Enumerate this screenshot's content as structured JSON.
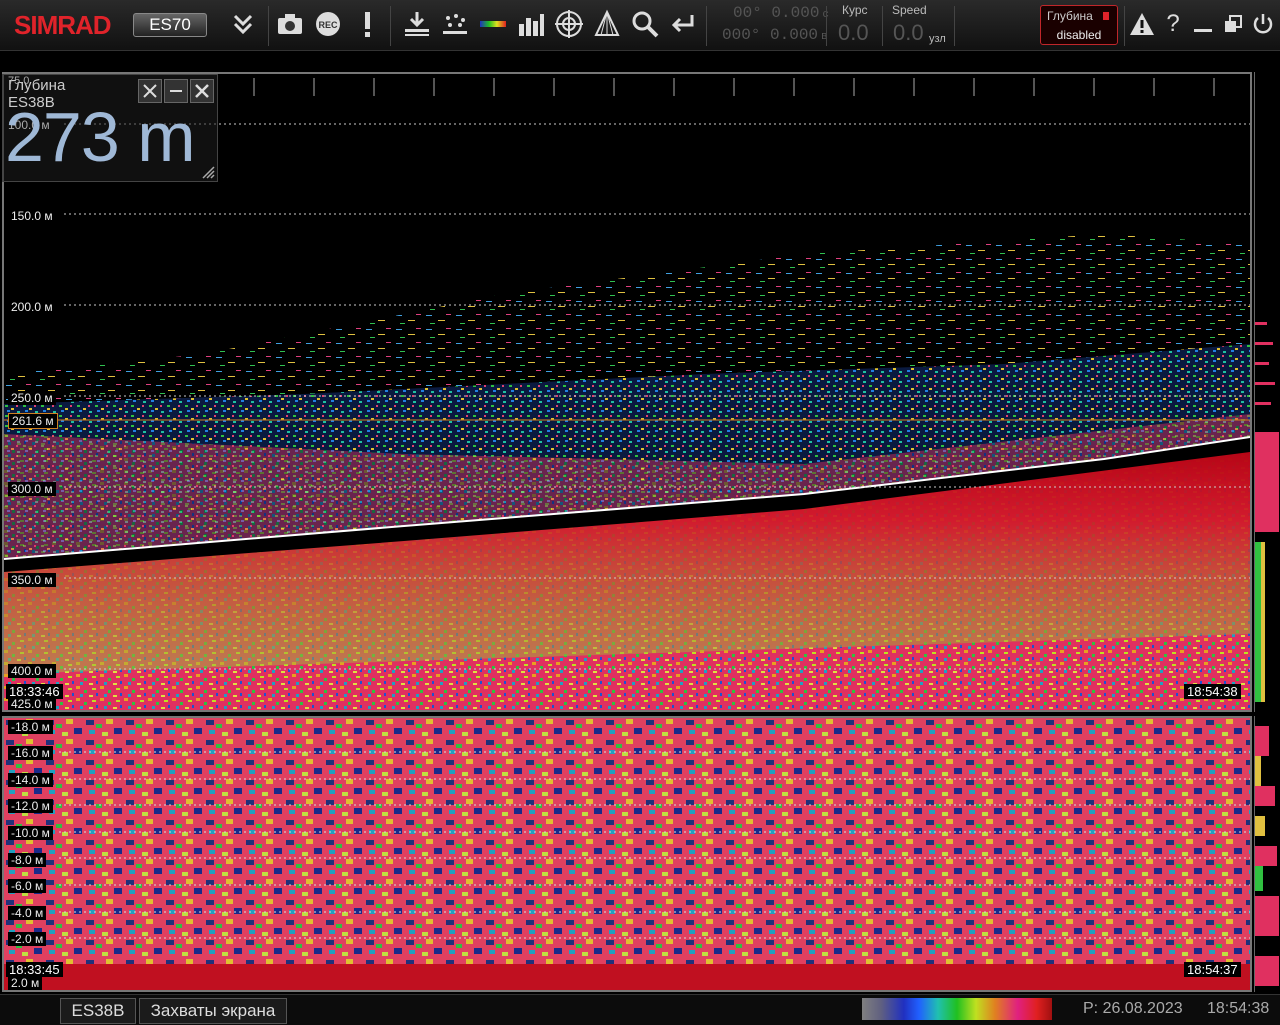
{
  "toolbar": {
    "logo": "SIMRAD",
    "model": "ES70",
    "lat": "00° 0.000",
    "lat_hem": "c",
    "lon": "000° 0.000",
    "lon_hem": "в",
    "course_label": "Курс",
    "course_value": "0.0",
    "speed_label": "Speed",
    "speed_value": "0.0",
    "speed_unit": "узл",
    "alarm_label": "Глубина",
    "alarm_state": "disabled",
    "help": "?",
    "record_label": "REC",
    "icons": [
      "expand-icon",
      "camera-icon",
      "record-icon",
      "event-icon",
      "bottom-icon",
      "noise-icon",
      "palette-icon",
      "histogram-icon",
      "target-icon",
      "transducer-icon",
      "zoom-icon",
      "back-icon",
      "warning-icon",
      "help-icon",
      "minimize-icon",
      "restore-icon",
      "power-icon"
    ]
  },
  "depth_panel": {
    "title": "Глубина",
    "channel": "ES38B",
    "value": "273 m",
    "range_top": "75.0",
    "tick_top": "100.0 м"
  },
  "echogram": {
    "depth_labels": [
      "150.0 м",
      "200.0 м",
      "250.0 м",
      "300.0 м",
      "350.0 м",
      "400.0 м",
      "425.0 м"
    ],
    "marker": "261.6 м",
    "start_time": "18:33:46",
    "end_time": "18:54:38"
  },
  "bottom_echogram": {
    "depth_labels": [
      "-18.0 м",
      "-16.0 м",
      "-14.0 м",
      "-12.0 м",
      "-10.0 м",
      "-8.0 м",
      "-6.0 м",
      "-4.0 м",
      "-2.0 м",
      "2.0 м"
    ],
    "start_time": "18:33:45",
    "end_time": "18:54:37"
  },
  "statusbar": {
    "tab1": "ES38B",
    "tab2": "Захваты экрана",
    "date": "P: 26.08.2023",
    "time": "18:54:38"
  },
  "colors": {
    "accent": "#e0232a",
    "depth_value": "#9fb8d6",
    "marker": "#d08020"
  }
}
